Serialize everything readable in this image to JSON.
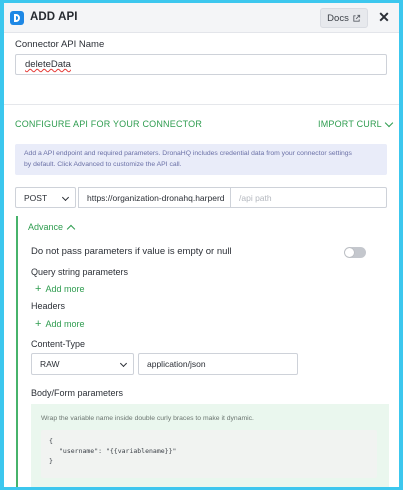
{
  "dialog": {
    "title": "ADD API",
    "docs_label": "Docs",
    "close_glyph": "✕"
  },
  "connector": {
    "label": "Connector API Name",
    "value": "deleteData"
  },
  "config": {
    "title": "CONFIGURE API FOR YOUR CONNECTOR",
    "import_label": "IMPORT CURL",
    "info_line1": "Add a API endpoint and required parameters. DronaHQ includes credential data from your connector settings",
    "info_line2": "by default. Click Advanced to customize the API call."
  },
  "request": {
    "method": "POST",
    "base_url": "https://organization-dronahq.harperd",
    "path_placeholder": "/api path"
  },
  "advance": {
    "label": "Advance",
    "skip_empty_label": "Do not pass parameters if value is empty or null",
    "skip_empty_enabled": false,
    "query_label": "Query string parameters",
    "query_add": "Add more",
    "headers_label": "Headers",
    "headers_add": "Add more",
    "content_type_label": "Content-Type",
    "content_type_mode": "RAW",
    "content_type_value": "application/json",
    "body_label": "Body/Form parameters",
    "body_hint": "Wrap the variable name inside double curly braces to make it dynamic.",
    "code_open": "{",
    "code_line": "\"username\": \"{{variablename}}\"",
    "code_close": "}"
  },
  "colors": {
    "accent_green": "#2e9c4f",
    "frame_blue": "#3cc7ee",
    "logo_blue": "#1e88e5"
  },
  "icons": {
    "logo": "dronahq-logo-icon",
    "docs": "external-link-icon",
    "close": "close-icon",
    "import": "chevron-down-icon",
    "advance": "chevron-up-icon",
    "add": "plus-icon"
  }
}
